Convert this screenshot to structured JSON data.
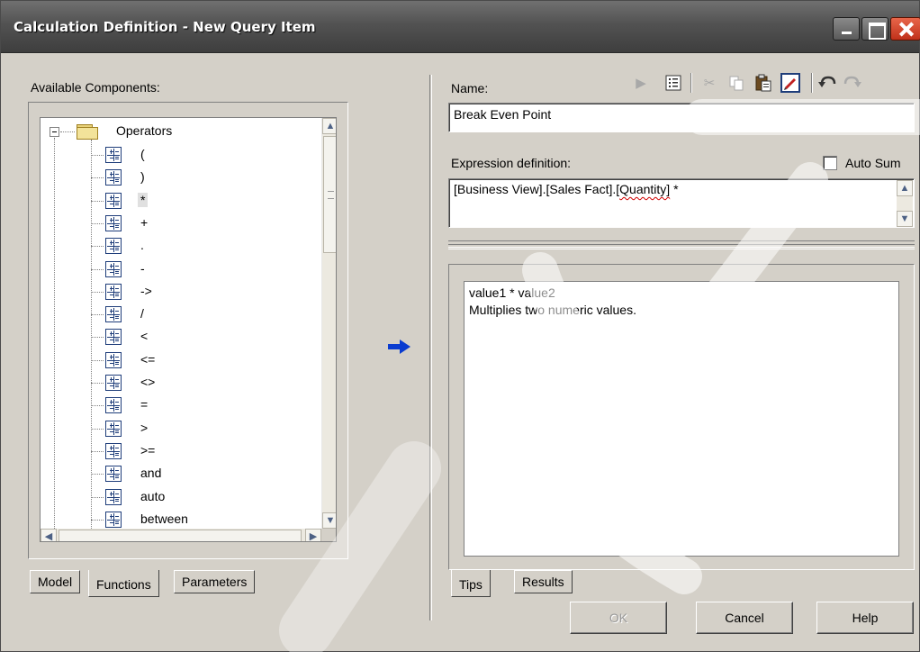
{
  "window": {
    "title": "Calculation Definition - New Query Item"
  },
  "left": {
    "available_label": "Available Components:",
    "tree": {
      "root_label": "Operators",
      "items": [
        "(",
        ")",
        "*",
        "+",
        ".",
        "-",
        "->",
        "/",
        "<",
        "<=",
        "<>",
        "=",
        ">",
        ">=",
        "and",
        "auto",
        "between"
      ],
      "selected": "*"
    },
    "tabs": [
      "Model",
      "Functions",
      "Parameters"
    ],
    "active_tab": "Functions"
  },
  "right": {
    "name_label": "Name:",
    "name_value": "Break Even Point",
    "expression_label": "Expression definition:",
    "expression_prefix": "[Business View].[Sales Fact].[",
    "expression_squiggle": "Quantity]",
    "expression_suffix": " *",
    "auto_sum_label": "Auto Sum",
    "auto_sum_checked": false,
    "tips_line1": "value1 * value2",
    "tips_line2": "Multiplies two numeric values.",
    "tabs": [
      "Tips",
      "Results"
    ],
    "active_tab": "Tips"
  },
  "toolbar": {
    "icons": [
      "run-icon",
      "properties-icon",
      "cut-icon",
      "copy-icon",
      "paste-icon",
      "edit-icon",
      "undo-icon",
      "redo-icon"
    ]
  },
  "buttons": {
    "ok": "OK",
    "cancel": "Cancel",
    "help": "Help"
  },
  "colors": {
    "arrow": "#0a3cd0",
    "title_bar": "#525252"
  }
}
